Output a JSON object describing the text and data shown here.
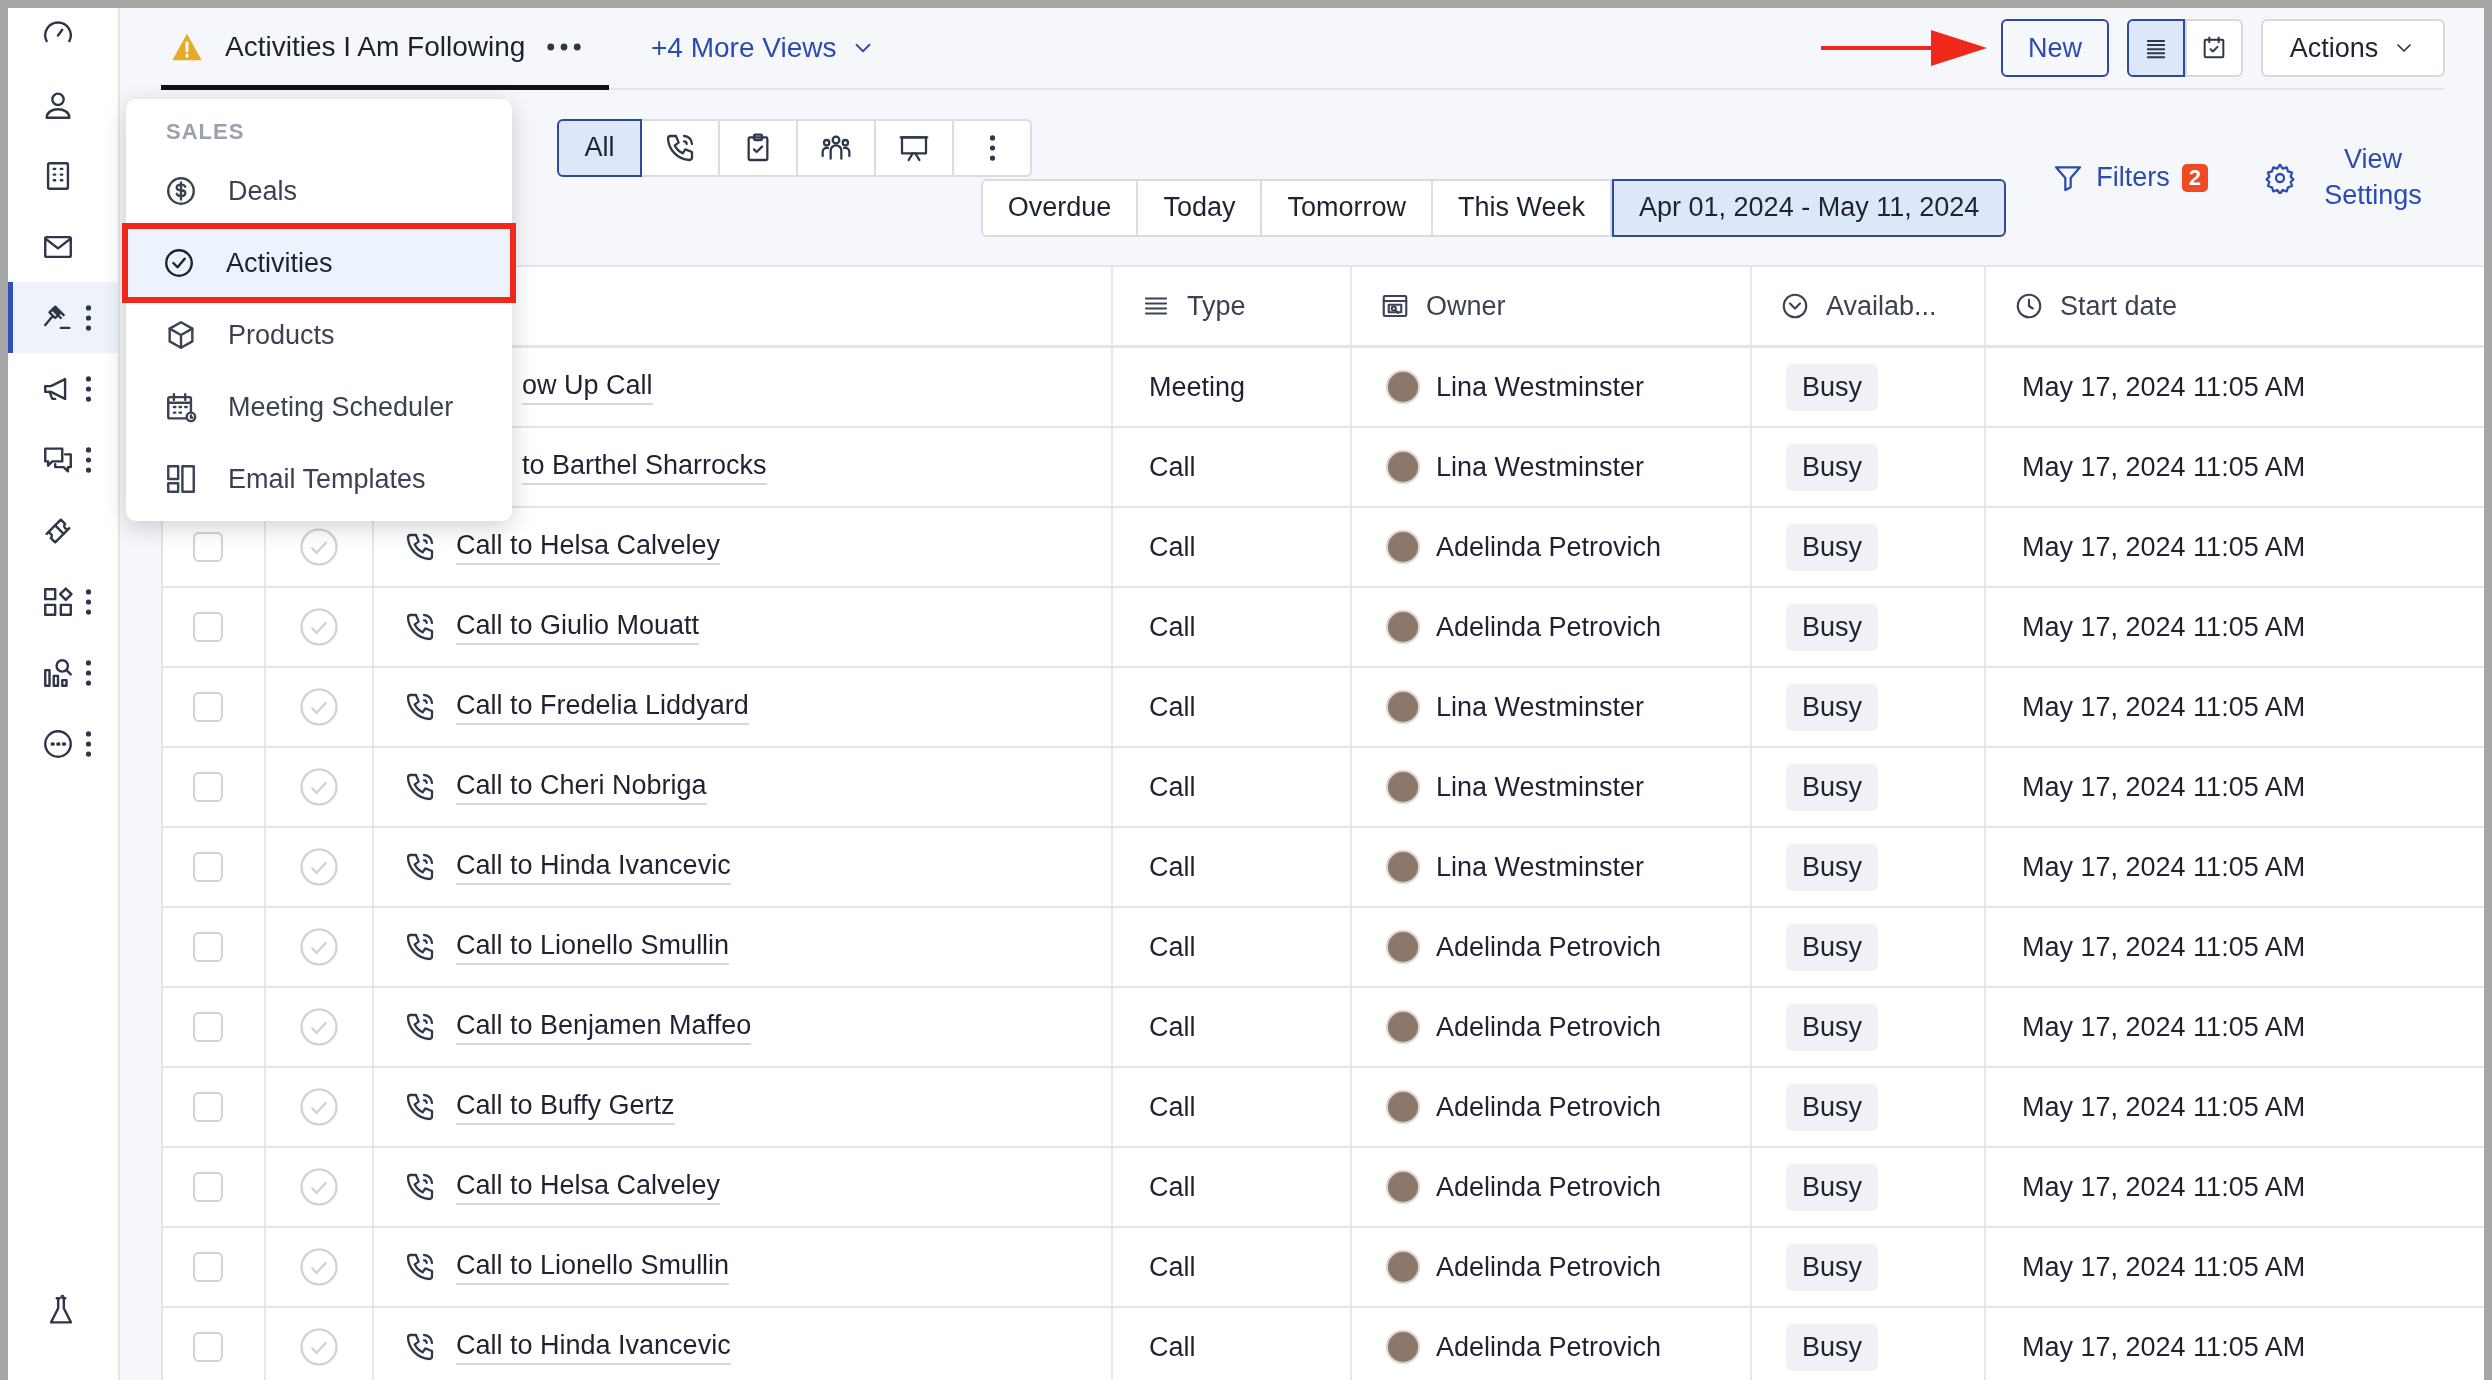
{
  "sidebar": {
    "items": [
      {
        "selected": false,
        "has_menu": false
      },
      {
        "selected": false,
        "has_menu": false
      },
      {
        "selected": false,
        "has_menu": false
      },
      {
        "selected": false,
        "has_menu": false
      },
      {
        "selected": true,
        "has_menu": true
      },
      {
        "selected": false,
        "has_menu": true
      },
      {
        "selected": false,
        "has_menu": true
      },
      {
        "selected": false,
        "has_menu": false
      },
      {
        "selected": false,
        "has_menu": true
      },
      {
        "selected": false,
        "has_menu": true
      },
      {
        "selected": false,
        "has_menu": true
      }
    ]
  },
  "view_tab": {
    "title": "Activities I Am Following",
    "warning": true,
    "selected": true
  },
  "more_views": "+4 More Views",
  "new_button": {
    "label": "New",
    "annotated": true
  },
  "view_toggle": [
    {
      "kind": "list",
      "selected": true
    },
    {
      "kind": "calendar",
      "selected": false
    }
  ],
  "actions_button": "Actions",
  "type_filters": [
    {
      "kind": "text",
      "label": "All",
      "selected": true
    },
    {
      "kind": "phone",
      "selected": false
    },
    {
      "kind": "task",
      "selected": false
    },
    {
      "kind": "people",
      "selected": false
    },
    {
      "kind": "presentation",
      "selected": false
    },
    {
      "kind": "more",
      "selected": false
    }
  ],
  "date_filters": [
    {
      "label": "Overdue",
      "selected": false
    },
    {
      "label": "Today",
      "selected": false
    },
    {
      "label": "Tomorrow",
      "selected": false
    },
    {
      "label": "This Week",
      "selected": false
    },
    {
      "label": "Apr 01, 2024 - May 11, 2024",
      "selected": true
    }
  ],
  "filters": {
    "label": "Filters",
    "count": "2"
  },
  "view_settings": "View Settings",
  "menu": {
    "section": "SALES",
    "items": [
      {
        "kind": "deals",
        "label": "Deals",
        "selected": false,
        "annotated": false
      },
      {
        "kind": "activities",
        "label": "Activities",
        "selected": true,
        "annotated": true
      },
      {
        "kind": "products",
        "label": "Products",
        "selected": false,
        "annotated": false
      },
      {
        "kind": "scheduler",
        "label": "Meeting Scheduler",
        "selected": false,
        "annotated": false
      },
      {
        "kind": "templates",
        "label": "Email Templates",
        "selected": false,
        "annotated": false
      }
    ]
  },
  "table": {
    "columns": [
      {
        "kind": "type",
        "label": "Type"
      },
      {
        "kind": "owner",
        "label": "Owner"
      },
      {
        "kind": "availability",
        "label": "Availab..."
      },
      {
        "kind": "start",
        "label": "Start date"
      }
    ],
    "rows": [
      {
        "partly_hidden": true,
        "title": "ow Up Call",
        "type": "Meeting",
        "owner": "Lina Westminster",
        "availability": "Busy",
        "start": "May 17, 2024 11:05 AM"
      },
      {
        "partly_hidden": true,
        "title": "to Barthel Sharrocks",
        "type": "Call",
        "owner": "Lina Westminster",
        "availability": "Busy",
        "start": "May 17, 2024 11:05 AM"
      },
      {
        "partly_hidden": false,
        "checked": false,
        "done": false,
        "title": "Call to Helsa Calveley",
        "type": "Call",
        "owner": "Adelinda Petrovich",
        "availability": "Busy",
        "start": "May 17, 2024 11:05 AM"
      },
      {
        "partly_hidden": false,
        "checked": false,
        "done": false,
        "title": "Call to Giulio Mouatt",
        "type": "Call",
        "owner": "Adelinda Petrovich",
        "availability": "Busy",
        "start": "May 17, 2024 11:05 AM"
      },
      {
        "partly_hidden": false,
        "checked": false,
        "done": false,
        "title": "Call to Fredelia Liddyard",
        "type": "Call",
        "owner": "Lina Westminster",
        "availability": "Busy",
        "start": "May 17, 2024 11:05 AM"
      },
      {
        "partly_hidden": false,
        "checked": false,
        "done": false,
        "title": "Call to Cheri Nobriga",
        "type": "Call",
        "owner": "Lina Westminster",
        "availability": "Busy",
        "start": "May 17, 2024 11:05 AM"
      },
      {
        "partly_hidden": false,
        "checked": false,
        "done": false,
        "title": "Call to Hinda Ivancevic",
        "type": "Call",
        "owner": "Lina Westminster",
        "availability": "Busy",
        "start": "May 17, 2024 11:05 AM"
      },
      {
        "partly_hidden": false,
        "checked": false,
        "done": false,
        "title": "Call to Lionello Smullin",
        "type": "Call",
        "owner": "Adelinda Petrovich",
        "availability": "Busy",
        "start": "May 17, 2024 11:05 AM"
      },
      {
        "partly_hidden": false,
        "checked": false,
        "done": false,
        "title": "Call to Benjamen Maffeo",
        "type": "Call",
        "owner": "Adelinda Petrovich",
        "availability": "Busy",
        "start": "May 17, 2024 11:05 AM"
      },
      {
        "partly_hidden": false,
        "checked": false,
        "done": false,
        "title": "Call to Buffy Gertz",
        "type": "Call",
        "owner": "Adelinda Petrovich",
        "availability": "Busy",
        "start": "May 17, 2024 11:05 AM"
      },
      {
        "partly_hidden": false,
        "checked": false,
        "done": false,
        "title": "Call to Helsa Calveley",
        "type": "Call",
        "owner": "Adelinda Petrovich",
        "availability": "Busy",
        "start": "May 17, 2024 11:05 AM"
      },
      {
        "partly_hidden": false,
        "checked": false,
        "done": false,
        "title": "Call to Lionello Smullin",
        "type": "Call",
        "owner": "Adelinda Petrovich",
        "availability": "Busy",
        "start": "May 17, 2024 11:05 AM"
      },
      {
        "partly_hidden": false,
        "checked": false,
        "done": false,
        "title": "Call to Hinda Ivancevic",
        "type": "Call",
        "owner": "Adelinda Petrovich",
        "availability": "Busy",
        "start": "May 17, 2024 11:05 AM"
      }
    ]
  }
}
